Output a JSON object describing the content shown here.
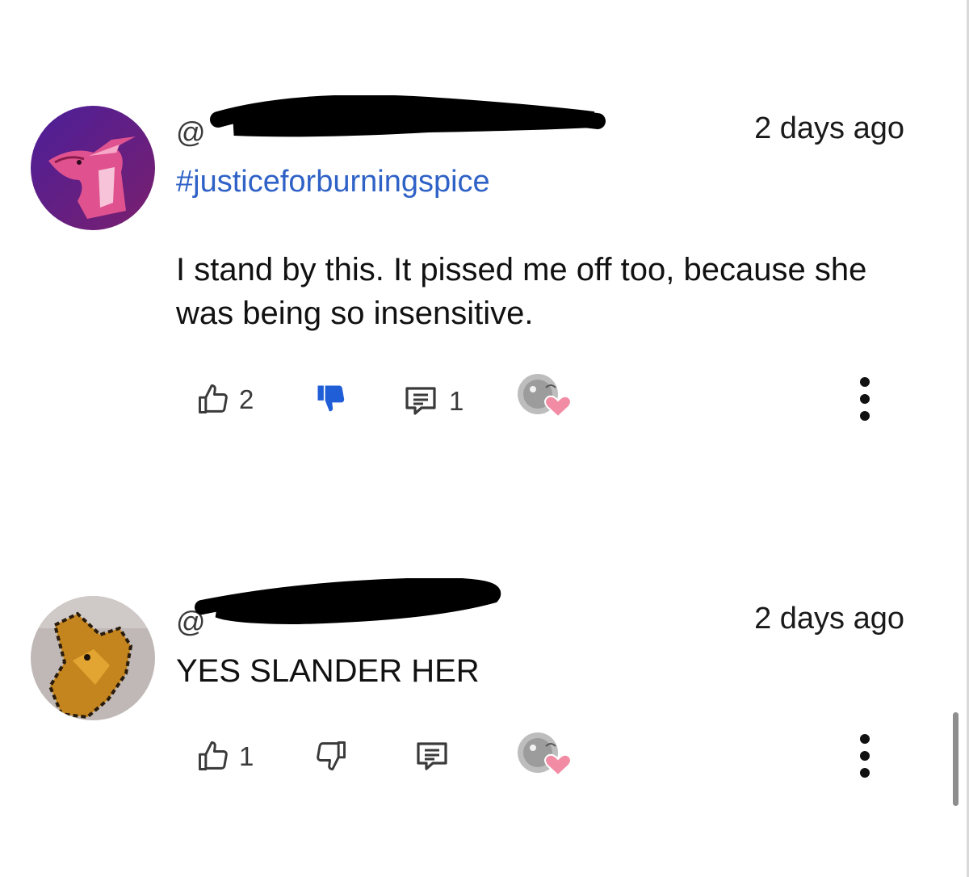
{
  "comments": [
    {
      "handle": "@",
      "timestamp": "2 days ago",
      "hashtag": "#justiceforburningspice",
      "text": "I stand by this. It pissed me off too, because she was being so insensitive.",
      "likes": "2",
      "replies": "1",
      "disliked": true,
      "avatar_icon": "dragon-avatar-pink",
      "accent_color": "#2f62c6"
    },
    {
      "handle": "@",
      "timestamp": "2 days ago",
      "text": "YES SLANDER HER",
      "likes": "1",
      "replies": "",
      "disliked": false,
      "avatar_icon": "dragon-avatar-orange"
    }
  ],
  "icons": {
    "like": "thumbs-up-icon",
    "dislike": "thumbs-down-icon",
    "reply": "reply-bubble-icon",
    "creator_heart": "creator-heart-icon",
    "more": "more-vertical-icon"
  }
}
